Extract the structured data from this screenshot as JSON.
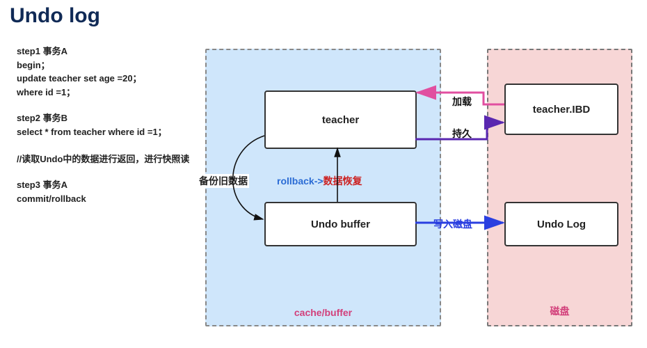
{
  "title": "Undo log",
  "steps": {
    "s1": "step1 事务A\nbegin；\nupdate teacher set age =20；\nwhere id =1；",
    "s2": "step2 事务B\nselect * from teacher where id =1；\n\n//读取Undo中的数据进行返回，进行快照读",
    "s3": "step3 事务A\ncommit/rollback"
  },
  "panels": {
    "cache": "cache/buffer",
    "disk": "磁盘"
  },
  "boxes": {
    "teacher": "teacher",
    "undo_buffer": "Undo buffer",
    "teacher_ibd": "teacher.IBD",
    "undo_log": "Undo Log"
  },
  "labels": {
    "backup": "备份旧数据",
    "rollback_prefix": "rollback->",
    "rollback_suffix": "数据恢复",
    "load": "加载",
    "persist": "持久",
    "write_disk": "写入磁盘"
  }
}
